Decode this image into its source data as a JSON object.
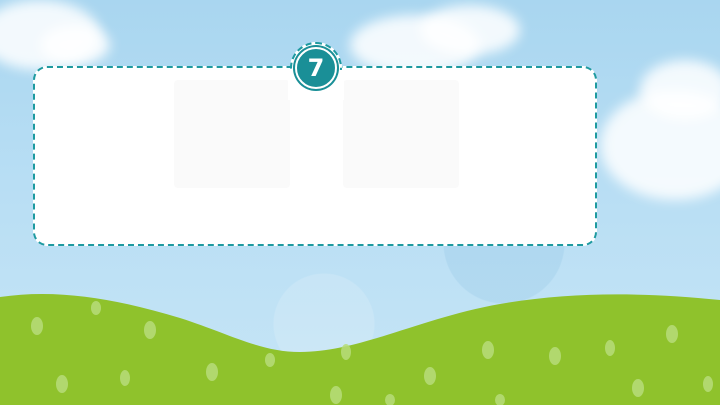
{
  "slide": {
    "badge_number": "7",
    "colors": {
      "sky": "#b8def4",
      "grass": "#8fc22c",
      "grass_dots": "#b7dd7a",
      "accent_teal": "#1e9aa0",
      "card": "#ffffff"
    },
    "icons": [
      "number-badge",
      "cloud",
      "grass-hill"
    ]
  }
}
